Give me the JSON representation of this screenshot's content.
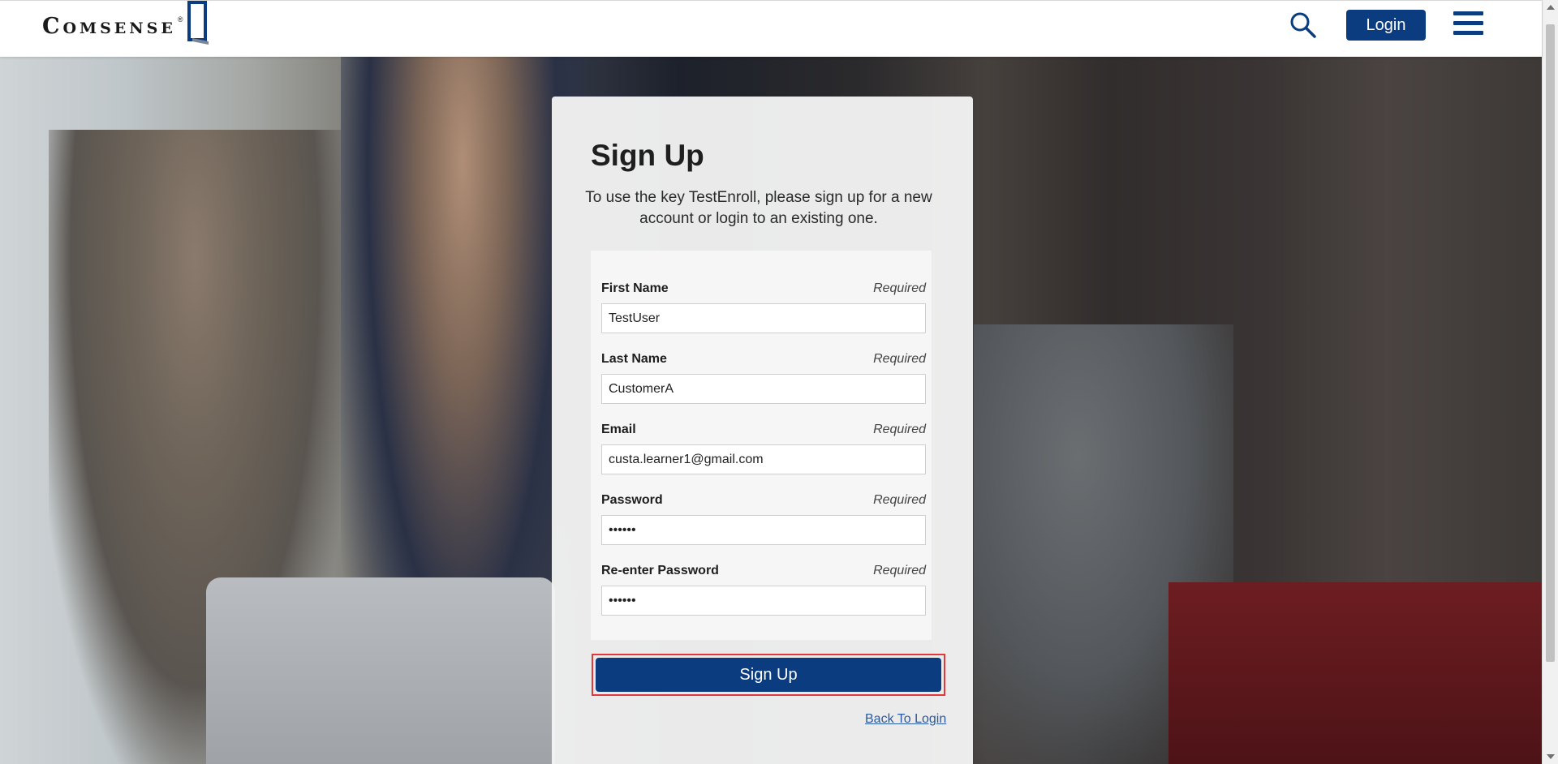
{
  "header": {
    "logo_text": "Comsense",
    "logo_mark": "®",
    "search_icon": "search-icon",
    "login_label": "Login",
    "menu_icon": "hamburger-menu-icon"
  },
  "colors": {
    "brand": "#0c3c80",
    "highlight": "#e0383b",
    "link": "#2a5aa0"
  },
  "signup": {
    "title": "Sign Up",
    "description": "To use the key TestEnroll, please sign up for a new account or login to an existing one.",
    "fields": [
      {
        "label": "First Name",
        "required": "Required",
        "value": "TestUser",
        "type": "text"
      },
      {
        "label": "Last Name",
        "required": "Required",
        "value": "CustomerA",
        "type": "text"
      },
      {
        "label": "Email",
        "required": "Required",
        "value": "custa.learner1@gmail.com",
        "type": "text"
      },
      {
        "label": "Password",
        "required": "Required",
        "value": "••••••",
        "type": "password"
      },
      {
        "label": "Re-enter Password",
        "required": "Required",
        "value": "••••••",
        "type": "password"
      }
    ],
    "submit_label": "Sign Up",
    "back_link": "Back To Login"
  }
}
